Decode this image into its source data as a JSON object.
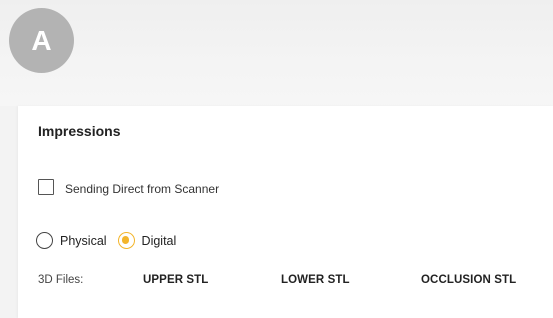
{
  "badge": {
    "letter": "A"
  },
  "impressions": {
    "title": "Impressions",
    "direct_scanner": {
      "label": "Sending Direct from Scanner",
      "checked": false
    },
    "impression_type": {
      "options": [
        {
          "label": "Physical",
          "selected": false
        },
        {
          "label": "Digital",
          "selected": true
        }
      ]
    },
    "files": {
      "label": "3D Files:",
      "buttons": [
        "UPPER STL",
        "LOWER STL",
        "OCCLUSION STL"
      ]
    }
  },
  "colors": {
    "accent": "#f3b52b",
    "badge_bg": "#b3b3b3",
    "background": "#f3f3f3",
    "panel": "#ffffff"
  }
}
